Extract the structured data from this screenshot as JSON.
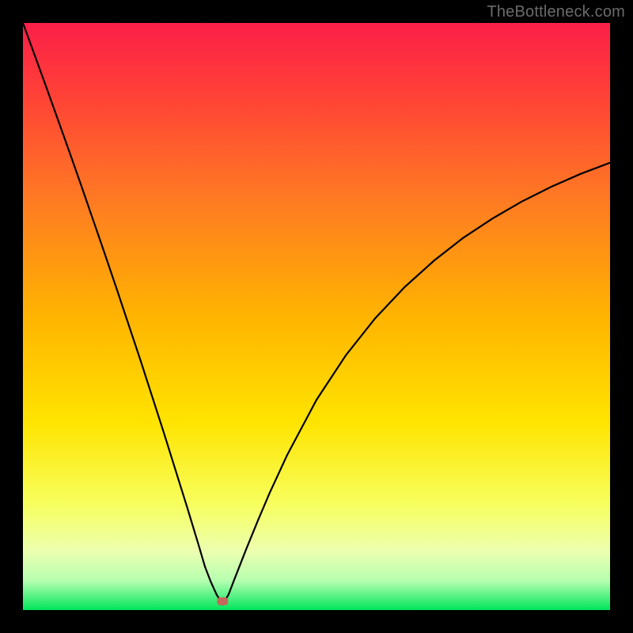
{
  "watermark": "TheBottleneck.com",
  "chart_data": {
    "type": "line",
    "title": "",
    "xlabel": "",
    "ylabel": "",
    "xlim": [
      0,
      100
    ],
    "ylim": [
      0,
      100
    ],
    "grid": false,
    "legend": false,
    "notch_x": 34,
    "marker": {
      "x": 34,
      "y": 1.5,
      "color": "#c3695b"
    },
    "series": [
      {
        "name": "curve",
        "x": [
          0,
          2,
          4,
          6,
          8,
          10,
          12,
          14,
          16,
          18,
          20,
          22,
          24,
          26,
          28,
          29,
          30,
          31,
          32,
          33,
          34,
          35,
          36,
          38,
          40,
          42,
          45,
          50,
          55,
          60,
          65,
          70,
          75,
          80,
          85,
          90,
          95,
          100
        ],
        "y": [
          100,
          94.5,
          89,
          83.4,
          77.8,
          72.1,
          66.3,
          60.5,
          54.6,
          48.6,
          42.6,
          36.4,
          30.2,
          23.8,
          17.4,
          14.1,
          10.8,
          7.4,
          4.8,
          2.6,
          1.0,
          2.6,
          5.2,
          10.3,
          15.2,
          19.9,
          26.4,
          35.8,
          43.4,
          49.7,
          55.0,
          59.5,
          63.4,
          66.7,
          69.6,
          72.1,
          74.3,
          76.2
        ]
      }
    ],
    "colors": {
      "curve": "#000000",
      "background_black": "#000000",
      "gradient_top": "#fc1f49",
      "gradient_mid1": "#ff8b1f",
      "gradient_mid2": "#ffe400",
      "gradient_mid3": "#f7ff5e",
      "gradient_bottom": "#00e55b"
    }
  }
}
